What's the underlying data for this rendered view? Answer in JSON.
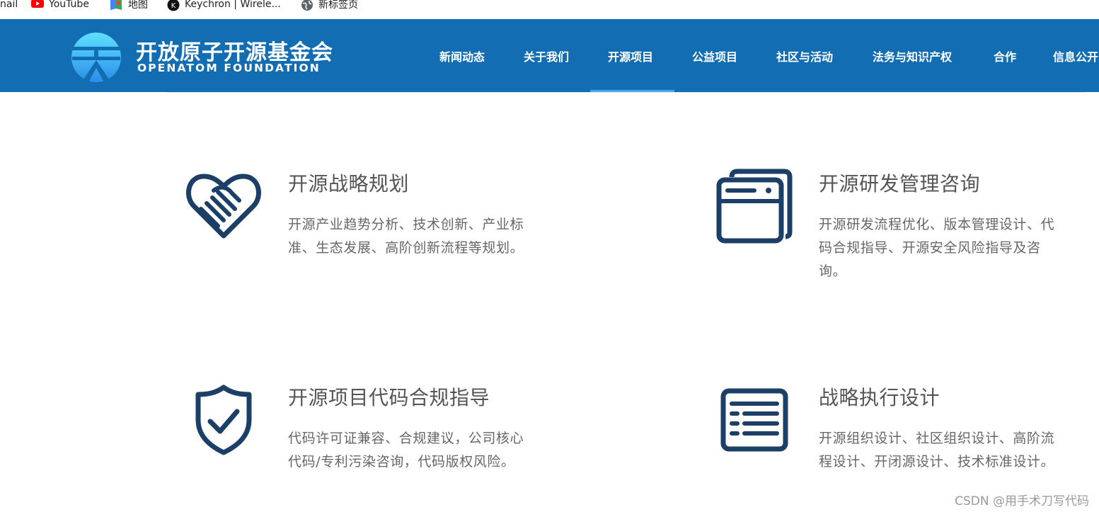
{
  "bookmarks": [
    {
      "label": "nail",
      "icon": "gmail-icon"
    },
    {
      "label": "YouTube",
      "icon": "youtube-icon"
    },
    {
      "label": "地图",
      "icon": "maps-icon"
    },
    {
      "label": "Keychron | Wirele...",
      "icon": "keychron-icon"
    },
    {
      "label": "新标签页",
      "icon": "globe-icon"
    }
  ],
  "header": {
    "logo_cn": "开放原子开源基金会",
    "logo_en": "OPENATOM FOUNDATION",
    "bg_color": "#136db3",
    "nav": [
      {
        "label": "新闻动态"
      },
      {
        "label": "关于我们"
      },
      {
        "label": "开源项目",
        "active": true
      },
      {
        "label": "公益项目"
      },
      {
        "label": "社区与活动"
      },
      {
        "label": "法务与知识产权"
      },
      {
        "label": "合作"
      },
      {
        "label": "信息公开"
      }
    ]
  },
  "features": [
    {
      "title": "开源战略规划",
      "desc": "开源产业趋势分析、技术创新、产业标准、生态发展、高阶创新流程等规划。",
      "icon": "handshake-heart-icon"
    },
    {
      "title": "开源研发管理咨询",
      "desc": "开源研发流程优化、版本管理设计、代码合规指导、开源安全风险指导及咨询。",
      "icon": "browser-windows-icon"
    },
    {
      "title": "开源项目代码合规指导",
      "desc": "代码许可证兼容、合规建议，公司核心代码/专利污染咨询，代码版权风险。",
      "icon": "shield-check-icon"
    },
    {
      "title": "战略执行设计",
      "desc": "开源组织设计、社区组织设计、高阶流程设计、开闭源设计、技术标准设计。",
      "icon": "list-document-icon"
    }
  ],
  "icon_color": "#1b3f66",
  "watermark": "CSDN @用手术刀写代码"
}
